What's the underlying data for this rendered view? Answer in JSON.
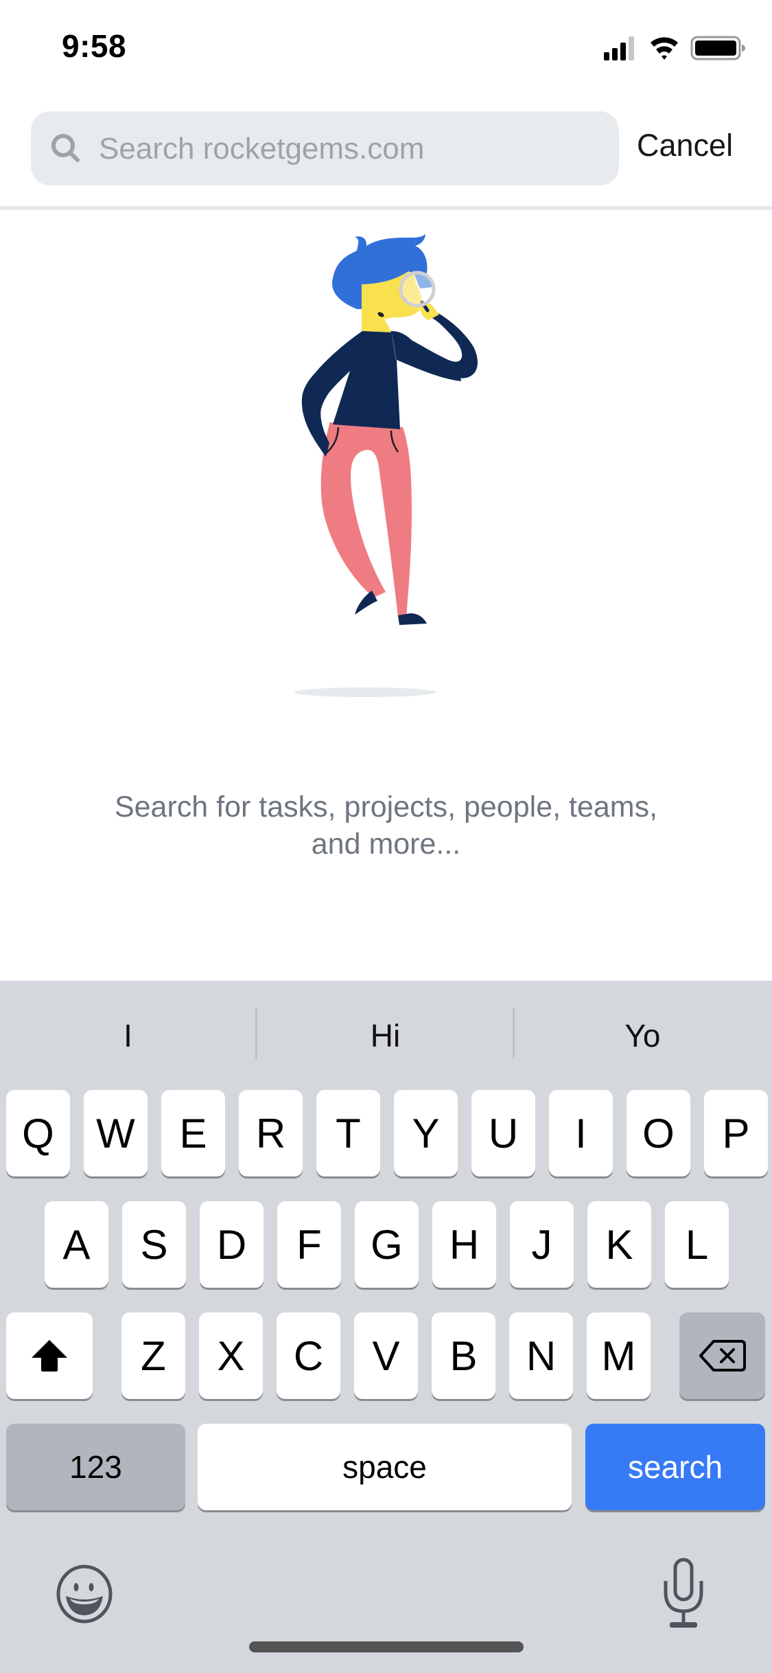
{
  "status_bar": {
    "time": "9:58",
    "icons": [
      "cellular-signal-icon",
      "wifi-icon",
      "battery-icon"
    ]
  },
  "search": {
    "placeholder": "Search rocketgems.com",
    "value": "",
    "icon": "search-icon",
    "cancel_label": "Cancel"
  },
  "empty_state": {
    "illustration": "person-with-magnifying-glass",
    "line1": "Search for tasks, projects, people, teams,",
    "line2": "and more..."
  },
  "keyboard": {
    "suggestions": [
      "I",
      "Hi",
      "Yo"
    ],
    "row1": [
      "Q",
      "W",
      "E",
      "R",
      "T",
      "Y",
      "U",
      "I",
      "O",
      "P"
    ],
    "row2": [
      "A",
      "S",
      "D",
      "F",
      "G",
      "H",
      "J",
      "K",
      "L"
    ],
    "row3": [
      "Z",
      "X",
      "C",
      "V",
      "B",
      "N",
      "M"
    ],
    "numbers_label": "123",
    "space_label": "space",
    "return_label": "search"
  },
  "colors": {
    "accent": "#377af6",
    "keyboard_bg": "#d4d7dc",
    "hair": "#3170d8",
    "skin": "#f9e04f",
    "shirt": "#0f2854",
    "pants": "#ef7c83"
  }
}
